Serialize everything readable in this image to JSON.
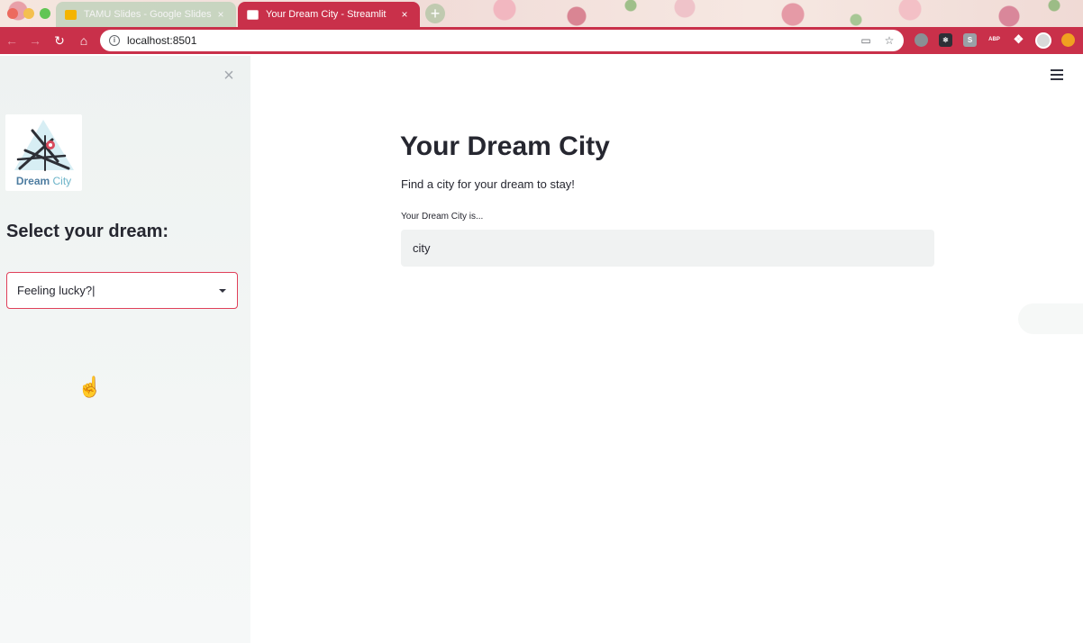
{
  "browser": {
    "tabs": [
      {
        "title": "TAMU Slides - Google Slides",
        "favicon_color": "#f4b400",
        "active": false
      },
      {
        "title": "Your Dream City - Streamlit",
        "favicon_color": "#ffffff",
        "active": true
      }
    ],
    "new_tab_label": "+",
    "close_glyph": "×",
    "url": "localhost:8501",
    "accent_color": "#c9304a",
    "extensions": [
      {
        "name": "grammar-ext-icon",
        "label": ""
      },
      {
        "name": "react-devtools-icon",
        "label": ""
      },
      {
        "name": "s-ext-icon",
        "label": "S"
      },
      {
        "name": "adblock-icon",
        "label": "ABP"
      },
      {
        "name": "extensions-puzzle-icon",
        "label": ""
      },
      {
        "name": "profile-avatar-icon",
        "label": ""
      },
      {
        "name": "update-icon",
        "label": ""
      }
    ]
  },
  "sidebar": {
    "close_label": "×",
    "logo": {
      "word1": "Dream",
      "word2": "City"
    },
    "heading": "Select your dream:",
    "select": {
      "value": "Feeling lucky?|",
      "border_color": "#e0405a"
    }
  },
  "main": {
    "title": "Your Dream City",
    "subtitle": "Find a city for your dream to stay!",
    "input_label": "Your Dream City is...",
    "input_value": "city"
  }
}
